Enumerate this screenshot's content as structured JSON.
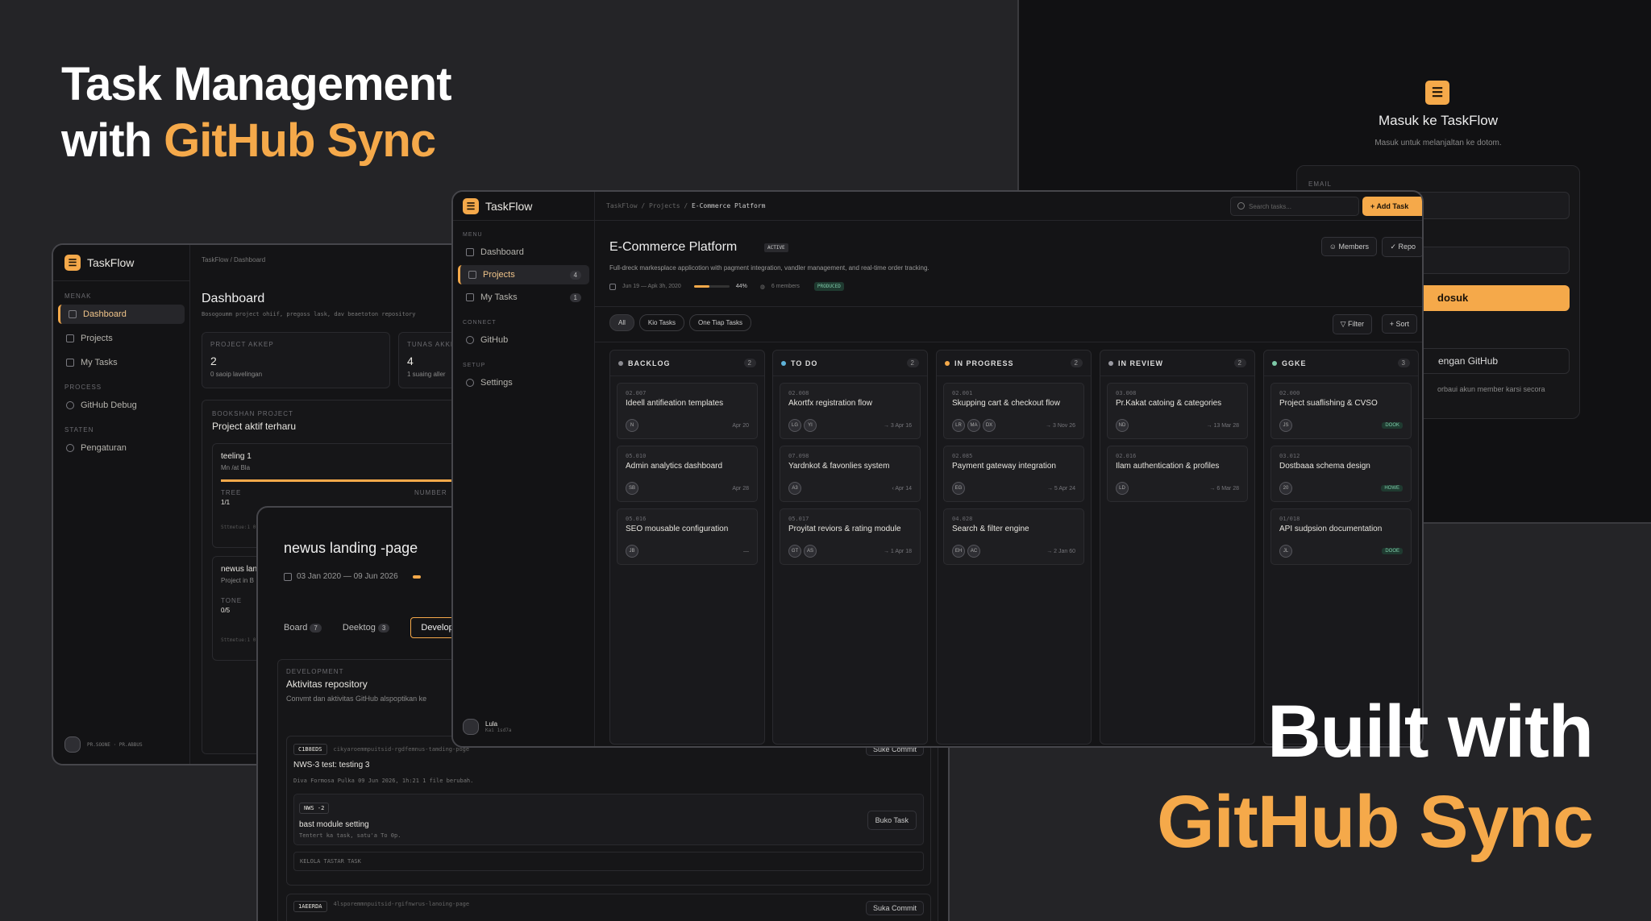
{
  "hero": {
    "line1": "Task Management",
    "line2a": "with ",
    "line2b": "GitHub Sync",
    "bottom1": "Built with",
    "bottom2": "GitHub Sync"
  },
  "brand": "TaskFlow",
  "login": {
    "title": "Masuk ke TaskFlow",
    "subtitle": "Masuk untuk melanjaltan ke dotom.",
    "email_label": "EMAIL",
    "submit": "dosuk",
    "github": "engan GitHub",
    "note": "orbaui akun member karsi secora"
  },
  "dashboard": {
    "crumb": "TaskFlow / Dashboard",
    "title": "Dashboard",
    "subtitle": "Bosogoumm project ohiif, pregoss lask, dav beaetoton repository",
    "section_menu": "MENAK",
    "nav": [
      "Dashboard",
      "Projects",
      "My Tasks"
    ],
    "section_process": "PROCESS",
    "nav_github": "GitHub Debug",
    "section_status": "STATEN",
    "nav_settings": "Pengaturan",
    "stat1_label": "PROJECT AKKEP",
    "stat1_value": "2",
    "stat1_sub": "0 saoip lavelingan",
    "stat2_label": "TUNAS AKKEP",
    "stat2_value": "4",
    "stat2_sub": "1 suaing aller",
    "recent_label": "BOOKSHAN PROJECT",
    "recent_title": "Project aktif terharu",
    "p1_name": "teeling 1",
    "p1_sub": "Mn /at Bla",
    "p1_k1": "TREE",
    "p1_v1": "1/1",
    "p1_k2": "NUMBER",
    "p1_foot": "Sttmetue:1 0",
    "p2_name": "newus lan",
    "p2_sub": "Project in B",
    "p2_k1": "TONE",
    "p2_v1": "0/5",
    "p2_foot": "Sttmetue:1 0",
    "user_foot": "PR.SOONE · PR.ABBUS"
  },
  "repo": {
    "title": "newus landing -page",
    "dates": "03 Jan 2020 — 09 Jun 2026",
    "tabs": [
      {
        "label": "Board",
        "count": "7"
      },
      {
        "label": "Deektog",
        "count": "3"
      },
      {
        "label": "Develop"
      }
    ],
    "dev_label": "DEVELOPMENT",
    "section_title": "Aktivitas repository",
    "section_sub": "Convmt dan aktivitas GitHub alspoptikan ke",
    "c1_hash": "C1B8EDS",
    "c1_branch": "cikyaroemmpuitsid-rgdfemnus-tamding-poge",
    "c1_action": "Suke Commit",
    "c1_title": "NWS-3 test: testing 3",
    "c1_meta": "Diva Formosa Pulka  09 Jun 2026, 1h:21  1 file berubah.",
    "t_badge": "NWS -2",
    "t_title": "bast module setting",
    "t_meta": "Tentert ka task, satu'a To 0p.",
    "t_action": "Buko Task",
    "kelola": "KELOLA TASTAR TASK",
    "c2_hash": "1AEERDA",
    "c2_branch": "4lsporemmnpuitsid-rgifnwrus-lanoing-page",
    "c2_action": "Suka Commit"
  },
  "main": {
    "crumb1": "TaskFlow",
    "crumb2": "Projects",
    "crumb3": "E-Commerce Platform",
    "search_placeholder": "Search tasks...",
    "add_task": "Add Task",
    "section_menu": "MENU",
    "nav": [
      {
        "label": "Dashboard"
      },
      {
        "label": "Projects",
        "count": "4"
      },
      {
        "label": "My Tasks",
        "count": "1"
      }
    ],
    "section_connect": "CONNECT",
    "nav_github": "GitHub",
    "section_setup": "SETUP",
    "nav_settings": "Settings",
    "user_name": "Lula",
    "user_sub": "Kai 1sd7a",
    "project_title": "E-Commerce Platform",
    "project_badge": "ACTIVE",
    "project_desc": "Full-dreck markesplace applicotion with pagment integration, vandler management, and real-time order tracking.",
    "project_dates": "Jun 19 — Apk 3h, 2020",
    "progress": 0.44,
    "progress_label": "44%",
    "members_meta": "6 members",
    "status_tag": "PRODUCED",
    "btn_members": "Members",
    "btn_repo": "Repo",
    "filters": [
      "All",
      "Kio Tasks",
      "One Tiap Tasks"
    ],
    "btn_filter": "Filter",
    "btn_sort": "Sort"
  },
  "board": [
    {
      "name": "BACKLOG",
      "count": "2",
      "color": "#8a8a90",
      "cards": [
        {
          "id": "02.007",
          "title": "Ideell antifieation templates",
          "av": [
            "N"
          ],
          "date": "Apr 20"
        },
        {
          "id": "05.010",
          "title": "Admin analytics dashboard",
          "av": [
            "SB"
          ],
          "date": "Apr 28"
        },
        {
          "id": "05.016",
          "title": "SEO mousable configuration",
          "av": [
            "JB"
          ],
          "date": "—"
        }
      ]
    },
    {
      "name": "TO DO",
      "count": "2",
      "color": "#5fb3d9",
      "cards": [
        {
          "id": "02.008",
          "title": "Akortfx registration flow",
          "av": [
            "LG",
            "YI"
          ],
          "date": "→ 3 Apr 16"
        },
        {
          "id": "07.098",
          "title": "Yardnkot & favonlies system",
          "av": [
            "A3"
          ],
          "date": "‹ Apr 14"
        },
        {
          "id": "05.017",
          "title": "Proyitat reviors & rating module",
          "av": [
            "GT",
            "AS"
          ],
          "date": "→ 1 Apr 18"
        }
      ]
    },
    {
      "name": "IN PROGRESS",
      "count": "2",
      "color": "#f5a94a",
      "cards": [
        {
          "id": "02.001",
          "title": "Skupping cart & checkout flow",
          "av": [
            "LR",
            "MA",
            "DX"
          ],
          "date": "→ 3 Nov 26"
        },
        {
          "id": "02.085",
          "title": "Payment gateway integration",
          "av": [
            "EG"
          ],
          "date": "→ 5 Apr 24"
        },
        {
          "id": "04.028",
          "title": "Search & filter engine",
          "av": [
            "EH",
            "AC"
          ],
          "date": "→ 2 Jan 60"
        }
      ]
    },
    {
      "name": "IN REVIEW",
      "count": "2",
      "color": "#9a9aa2",
      "cards": [
        {
          "id": "03.008",
          "title": "Pr.Kakat catoing & categories",
          "av": [
            "ND"
          ],
          "date": "→ 13 Mar 28"
        },
        {
          "id": "02.016",
          "title": "Ilam authentication & profiles",
          "av": [
            "LD"
          ],
          "date": "→ 6 Mar 28"
        }
      ]
    },
    {
      "name": "GGKE",
      "count": "3",
      "color": "#7ec9a8",
      "cards": [
        {
          "id": "02.000",
          "title": "Project suaflishing & CVSO",
          "av": [
            "JS"
          ],
          "tag": "DOOK"
        },
        {
          "id": "03.012",
          "title": "Dostbaaa schema design",
          "av": [
            "20"
          ],
          "tag": "HOWE"
        },
        {
          "id": "01/018",
          "title": "API sudpsion documentation",
          "av": [
            "JL"
          ],
          "tag": "DOOE"
        }
      ]
    }
  ]
}
